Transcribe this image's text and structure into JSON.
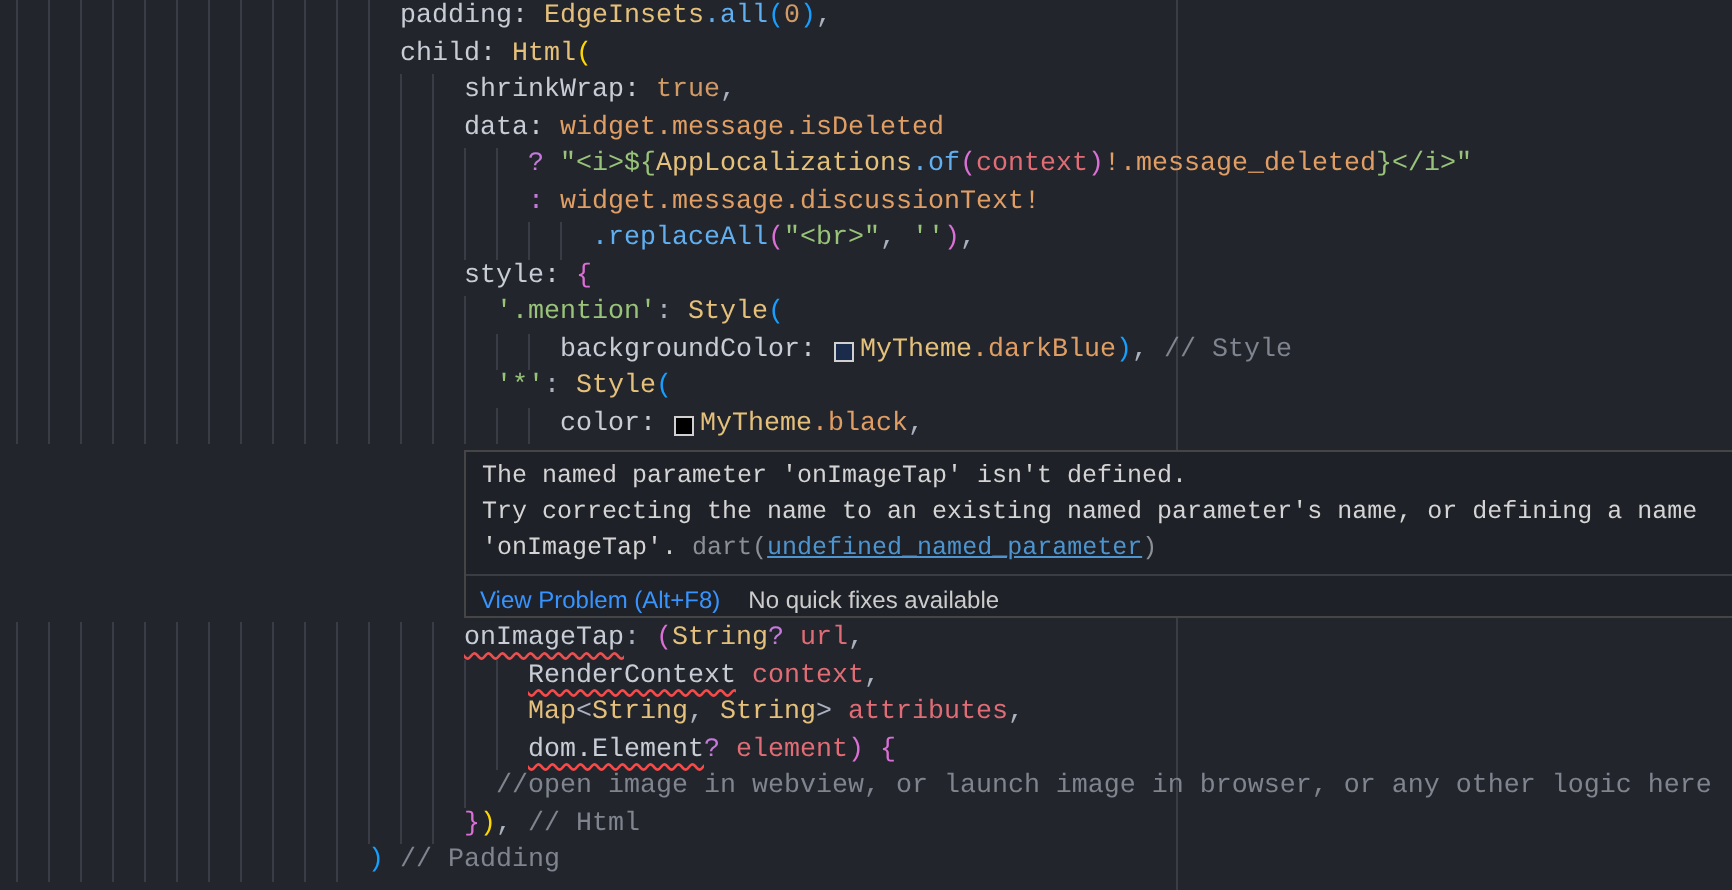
{
  "editor": {
    "lines_above": [
      {
        "tokens": [
          {
            "kind": "prop",
            "text": "                         padding: "
          },
          {
            "kind": "type",
            "text": "EdgeInsets"
          },
          {
            "kind": "method",
            "text": ".all"
          },
          {
            "kind": "bracket3",
            "text": "("
          },
          {
            "kind": "bool",
            "text": "0"
          },
          {
            "kind": "bracket3",
            "text": ")"
          },
          {
            "kind": "punct",
            "text": ","
          }
        ]
      },
      {
        "tokens": [
          {
            "kind": "prop",
            "text": "                         child: "
          },
          {
            "kind": "type",
            "text": "Html"
          },
          {
            "kind": "bracket1",
            "text": "("
          }
        ]
      },
      {
        "tokens": [
          {
            "kind": "prop",
            "text": "                             shrinkWrap: "
          },
          {
            "kind": "bool",
            "text": "true"
          },
          {
            "kind": "punct",
            "text": ","
          }
        ]
      },
      {
        "tokens": [
          {
            "kind": "prop",
            "text": "                             data: "
          },
          {
            "kind": "field",
            "text": "widget.message.isDeleted"
          }
        ]
      },
      {
        "tokens": [
          {
            "kind": "op",
            "text": "                                 ? "
          },
          {
            "kind": "string",
            "text": "\"<i>${"
          },
          {
            "kind": "type",
            "text": "AppLocalizations"
          },
          {
            "kind": "method",
            "text": ".of"
          },
          {
            "kind": "bracket2",
            "text": "("
          },
          {
            "kind": "param",
            "text": "context"
          },
          {
            "kind": "bracket2",
            "text": ")"
          },
          {
            "kind": "field",
            "text": "!.message_deleted"
          },
          {
            "kind": "string",
            "text": "}</i>\""
          }
        ]
      },
      {
        "tokens": [
          {
            "kind": "op",
            "text": "                                 : "
          },
          {
            "kind": "field",
            "text": "widget.message.discussionText!"
          }
        ]
      },
      {
        "tokens": [
          {
            "kind": "method",
            "text": "                                     .replaceAll"
          },
          {
            "kind": "bracket2",
            "text": "("
          },
          {
            "kind": "string",
            "text": "\"<br>\""
          },
          {
            "kind": "punct",
            "text": ", "
          },
          {
            "kind": "string",
            "text": "''"
          },
          {
            "kind": "bracket2",
            "text": ")"
          },
          {
            "kind": "punct",
            "text": ","
          }
        ]
      },
      {
        "tokens": [
          {
            "kind": "prop",
            "text": "                             style: "
          },
          {
            "kind": "bracket2",
            "text": "{"
          }
        ]
      },
      {
        "tokens": [
          {
            "kind": "string",
            "text": "                               '.mention'"
          },
          {
            "kind": "punct",
            "text": ": "
          },
          {
            "kind": "type",
            "text": "Style"
          },
          {
            "kind": "bracket3",
            "text": "("
          }
        ]
      },
      {
        "tokens": [
          {
            "kind": "prop",
            "text": "                                   backgroundColor: "
          },
          {
            "kind": "swatch",
            "color": "#1b2b4b"
          },
          {
            "kind": "type",
            "text": "MyTheme"
          },
          {
            "kind": "field",
            "text": ".darkBlue"
          },
          {
            "kind": "bracket3",
            "text": ")"
          },
          {
            "kind": "punct",
            "text": ", "
          },
          {
            "kind": "comment",
            "text": "// Style"
          }
        ]
      },
      {
        "tokens": [
          {
            "kind": "string",
            "text": "                               '*'"
          },
          {
            "kind": "punct",
            "text": ": "
          },
          {
            "kind": "type",
            "text": "Style"
          },
          {
            "kind": "bracket3",
            "text": "("
          }
        ]
      },
      {
        "tokens": [
          {
            "kind": "prop",
            "text": "                                   color: "
          },
          {
            "kind": "swatch",
            "color": "#000000"
          },
          {
            "kind": "type",
            "text": "MyTheme"
          },
          {
            "kind": "field",
            "text": ".black"
          },
          {
            "kind": "punct",
            "text": ","
          }
        ]
      }
    ],
    "hover": {
      "message": "The named parameter 'onImageTap' isn't defined.\nTry correcting the name to an existing named parameter's name, or defining a name\n'onImageTap'. ",
      "source": "dart(",
      "code_link": "undefined_named_parameter",
      "source_end": ")",
      "action": "View Problem (Alt+F8)",
      "status": "No quick fixes available"
    },
    "lines_below": [
      {
        "tokens": [
          {
            "kind": "prop",
            "text": "                             onImageTap",
            "error": true
          },
          {
            "kind": "punct",
            "text": ": "
          },
          {
            "kind": "bracket2",
            "text": "("
          },
          {
            "kind": "type",
            "text": "String"
          },
          {
            "kind": "op",
            "text": "? "
          },
          {
            "kind": "param",
            "text": "url"
          },
          {
            "kind": "punct",
            "text": ","
          }
        ]
      },
      {
        "tokens": [
          {
            "kind": "plain",
            "text": "                                 RenderContext",
            "error": true
          },
          {
            "kind": "param",
            "text": " context"
          },
          {
            "kind": "punct",
            "text": ","
          }
        ]
      },
      {
        "tokens": [
          {
            "kind": "type",
            "text": "                                 Map"
          },
          {
            "kind": "punct",
            "text": "<"
          },
          {
            "kind": "type",
            "text": "String"
          },
          {
            "kind": "punct",
            "text": ", "
          },
          {
            "kind": "type",
            "text": "String"
          },
          {
            "kind": "punct",
            "text": "> "
          },
          {
            "kind": "param",
            "text": "attributes"
          },
          {
            "kind": "punct",
            "text": ","
          }
        ]
      },
      {
        "tokens": [
          {
            "kind": "plain",
            "text": "                                 dom.Element",
            "error": true
          },
          {
            "kind": "op",
            "text": "? "
          },
          {
            "kind": "param",
            "text": "element"
          },
          {
            "kind": "bracket2",
            "text": ")"
          },
          {
            "kind": "bracket2",
            "text": " {"
          }
        ]
      },
      {
        "tokens": [
          {
            "kind": "comment",
            "text": "                               //open image in webview, or launch image in browser, or any other logic here"
          }
        ]
      },
      {
        "tokens": [
          {
            "kind": "bracket2",
            "text": "                             }"
          },
          {
            "kind": "bracket1",
            "text": ")"
          },
          {
            "kind": "punct",
            "text": ", "
          },
          {
            "kind": "comment",
            "text": "// Html"
          }
        ]
      },
      {
        "tokens": [
          {
            "kind": "bracket3",
            "text": "                       )"
          },
          {
            "kind": "comment",
            "text": " // Padding"
          }
        ]
      }
    ]
  }
}
